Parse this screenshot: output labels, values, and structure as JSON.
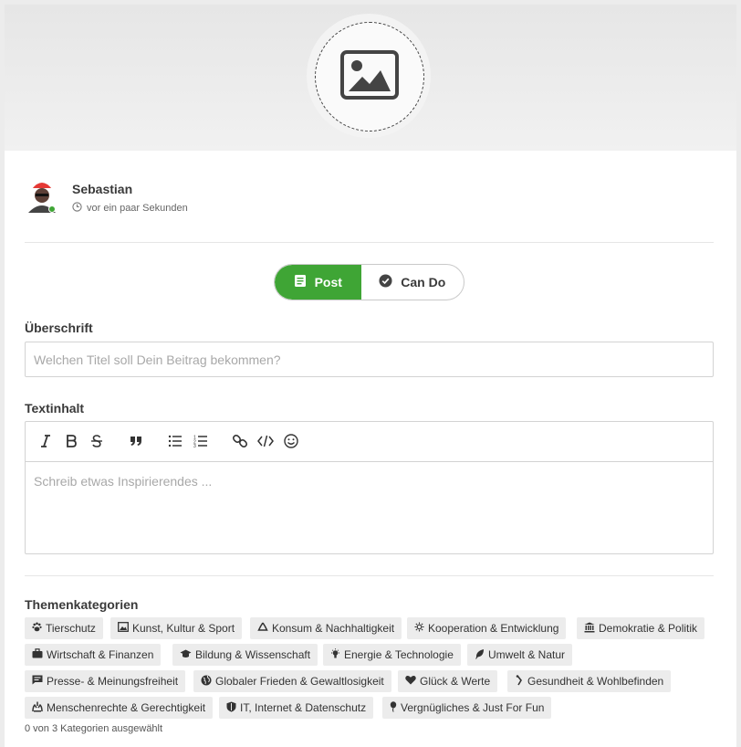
{
  "author": {
    "name": "Sebastian",
    "time": "vor ein paar Sekunden"
  },
  "post_type": {
    "options": [
      {
        "label": "Post",
        "icon": "document-icon",
        "selected": true
      },
      {
        "label": "Can Do",
        "icon": "check-circle-icon",
        "selected": false
      }
    ]
  },
  "headline": {
    "label": "Überschrift",
    "placeholder": "Welchen Titel soll Dein Beitrag bekommen?",
    "value": ""
  },
  "body": {
    "label": "Textinhalt",
    "placeholder": "Schreib etwas Inspirierendes ...",
    "toolbar": [
      "italic-icon",
      "bold-icon",
      "strikethrough-icon",
      "quote-icon",
      "bullet-list-icon",
      "numbered-list-icon",
      "link-icon",
      "code-icon",
      "emoji-icon"
    ]
  },
  "categories": {
    "label": "Themenkategorien",
    "items": [
      {
        "label": "Tierschutz",
        "icon": "paw-icon"
      },
      {
        "label": "Kunst, Kultur & Sport",
        "icon": "picture-icon"
      },
      {
        "label": "Konsum & Nachhaltigkeit",
        "icon": "recycle-icon"
      },
      {
        "label": "Kooperation & Entwicklung",
        "icon": "cog-icon"
      },
      {
        "label": "Demokratie & Politik",
        "icon": "institution-icon"
      },
      {
        "label": "Wirtschaft & Finanzen",
        "icon": "briefcase-icon"
      },
      {
        "label": "Bildung & Wissenschaft",
        "icon": "graduation-cap-icon"
      },
      {
        "label": "Energie & Technologie",
        "icon": "bulb-icon"
      },
      {
        "label": "Umwelt & Natur",
        "icon": "leaf-icon"
      },
      {
        "label": "Presse- & Meinungsfreiheit",
        "icon": "speech-icon"
      },
      {
        "label": "Globaler Frieden & Gewaltlosigkeit",
        "icon": "globe-icon"
      },
      {
        "label": "Glück & Werte",
        "icon": "heart-icon"
      },
      {
        "label": "Gesundheit & Wohlbefinden",
        "icon": "medkit-icon"
      },
      {
        "label": "Menschenrechte & Gerechtigkeit",
        "icon": "hands-icon"
      },
      {
        "label": "IT, Internet & Datenschutz",
        "icon": "shield-icon"
      },
      {
        "label": "Vergnügliches & Just For Fun",
        "icon": "balloon-icon"
      }
    ],
    "count_text": "0 von 3 Kategorien ausgewählt"
  },
  "colors": {
    "accent": "#3fa535",
    "chip_bg": "#ececec",
    "border": "#d3d3d3"
  }
}
